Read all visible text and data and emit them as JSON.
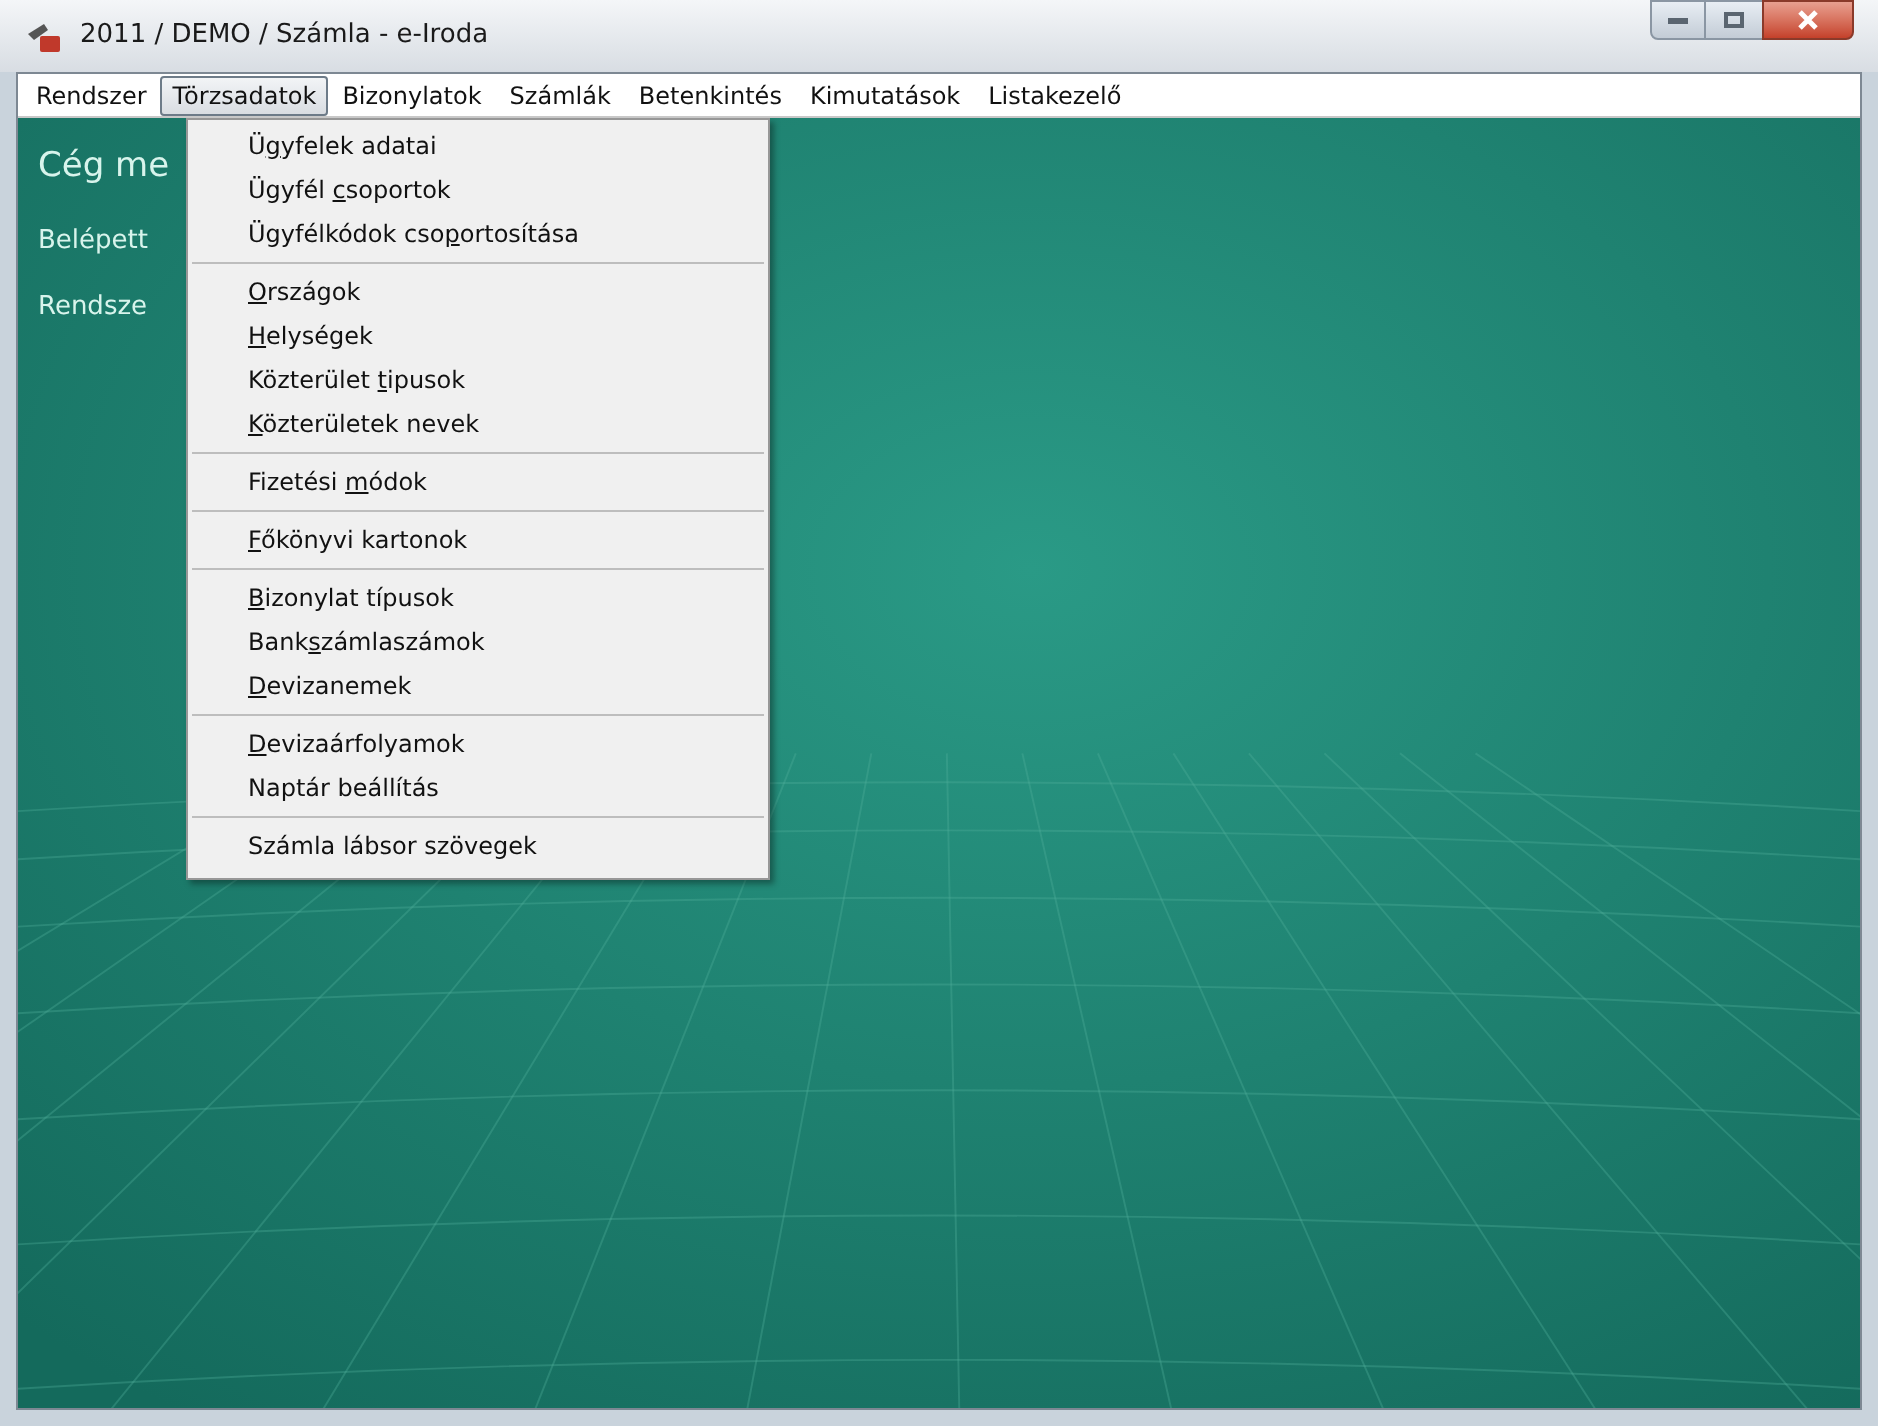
{
  "window": {
    "title": "2011 / DEMO / Számla - e-Iroda"
  },
  "menu_bar": [
    {
      "label": "Rendszer",
      "selected": false
    },
    {
      "label": "Törzsadatok",
      "selected": true
    },
    {
      "label": "Bizonylatok",
      "selected": false
    },
    {
      "label": "Számlák",
      "selected": false
    },
    {
      "label": "Betenkintés",
      "selected": false
    },
    {
      "label": "Kimutatások",
      "selected": false
    },
    {
      "label": "Listakezelő",
      "selected": false
    }
  ],
  "dropdown": {
    "groups": [
      [
        {
          "before": "Ü",
          "mnemonic": "g",
          "after": "yfelek adatai"
        },
        {
          "before": "Ügyfél ",
          "mnemonic": "c",
          "after": "soportok"
        },
        {
          "before": "Ügyfélkódok cso",
          "mnemonic": "p",
          "after": "ortosítása"
        }
      ],
      [
        {
          "mnemonic": "O",
          "after": "rszágok"
        },
        {
          "mnemonic": "H",
          "after": "elységek"
        },
        {
          "before": "Közterület ",
          "mnemonic": "t",
          "after": "ipusok"
        },
        {
          "mnemonic": "K",
          "after": "özterületek nevek"
        }
      ],
      [
        {
          "before": "Fizetési ",
          "mnemonic": "m",
          "after": "ódok"
        }
      ],
      [
        {
          "mnemonic": "F",
          "after": "őkönyvi kartonok"
        }
      ],
      [
        {
          "mnemonic": "B",
          "after": "izonylat típusok"
        },
        {
          "before": "Bank",
          "mnemonic": "s",
          "after": "zámlaszámok"
        },
        {
          "mnemonic": "D",
          "after": "evizanemek"
        }
      ],
      [
        {
          "mnemonic": "D",
          "after": "evizaárfolyamok"
        },
        {
          "before": "Naptár beállítás"
        }
      ],
      [
        {
          "before": "Számla lábsor szövegek"
        }
      ]
    ]
  },
  "background_texts": [
    {
      "text": "Cég me",
      "kind": "heading"
    },
    {
      "text": "Belépett",
      "kind": "line"
    },
    {
      "text": "Rendsze",
      "kind": "line"
    }
  ]
}
